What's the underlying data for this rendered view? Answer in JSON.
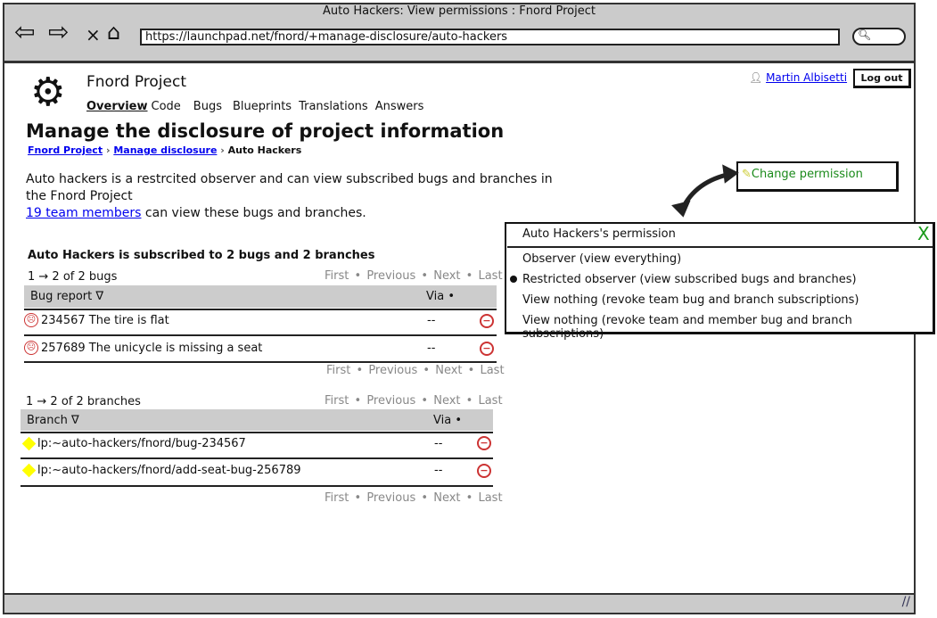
{
  "browser": {
    "title": "Auto Hackers: View permissions : Fnord Project",
    "url": "https://launchpad.net/fnord/+manage-disclosure/auto-hackers"
  },
  "header": {
    "project": "Fnord Project",
    "user": "Martin Albisetti",
    "logout": "Log out",
    "nav": [
      "Overview",
      "Code",
      "Bugs",
      "Blueprints",
      "Translations",
      "Answers"
    ]
  },
  "page": {
    "title": "Manage the disclosure of project information",
    "breadcrumb": [
      "Fnord Project",
      "Manage disclosure",
      "Auto Hackers"
    ],
    "desc1": "Auto hackers is a restrcited observer and can view subscribed bugs and branches in",
    "desc2": "the Fnord Project",
    "members_link": "19 team members",
    "members_rest": " can view these bugs and branches.",
    "change_permission": "Change permission",
    "subscribed_heading": "Auto Hackers is subscribed to 2 bugs and 2 branches"
  },
  "pagination": {
    "first": "First",
    "previous": "Previous",
    "next": "Next",
    "last": "Last",
    "sep": "•"
  },
  "bugs": {
    "count": "1 → 2 of 2 bugs",
    "col_main": "Bug report ∇",
    "col_via": "Via •",
    "rows": [
      {
        "title": "234567 The tire is flat",
        "via": "--"
      },
      {
        "title": "257689 The unicycle is missing a seat",
        "via": "--"
      }
    ]
  },
  "branches": {
    "count": "1 → 2 of 2 branches",
    "col_main": "Branch ∇",
    "col_via": "Via •",
    "rows": [
      {
        "title": "lp:~auto-hackers/fnord/bug-234567",
        "via": "--"
      },
      {
        "title": "lp:~auto-hackers/fnord/add-seat-bug-256789",
        "via": "--"
      }
    ]
  },
  "popup": {
    "title": "Auto Hackers's permission",
    "close": "X",
    "selected_index": 1,
    "options": [
      "Observer (view everything)",
      "Restricted observer (view subscribed bugs and branches)",
      "View nothing (revoke team bug and branch subscriptions)",
      "View nothing (revoke team and member bug and branch subscriptions)"
    ]
  }
}
